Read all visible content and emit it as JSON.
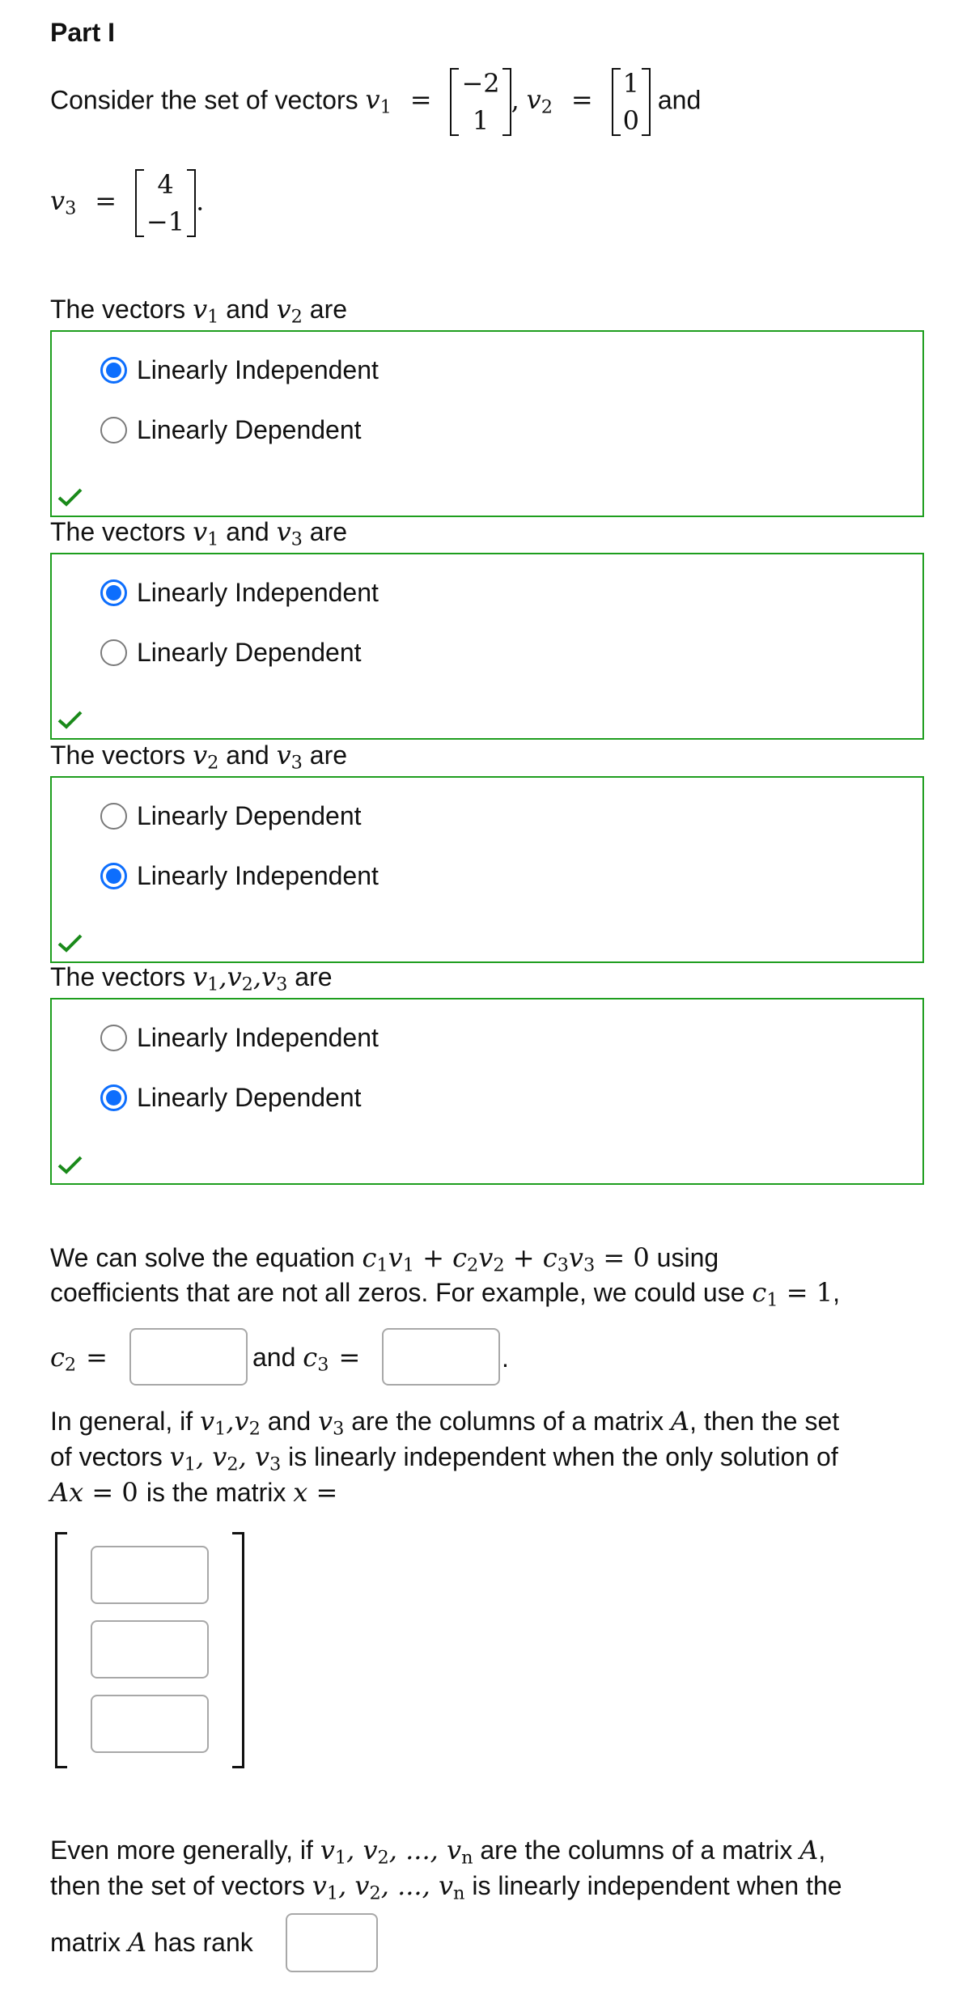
{
  "part_title": "Part I",
  "intro": {
    "prefix": "Consider the set of vectors",
    "v1_label": "v",
    "v1_sub": "1",
    "v1": [
      "−2",
      "1"
    ],
    "v2_label": "v",
    "v2_sub": "2",
    "v2": [
      "1",
      "0"
    ],
    "and": "and",
    "v3_label": "v",
    "v3_sub": "3",
    "v3": [
      "4",
      "−1"
    ],
    "eq": "=",
    "comma": ",",
    "period": "."
  },
  "questions": [
    {
      "label_prefix": "The vectors",
      "label_math": "v₁ and v₂",
      "a": "1",
      "b": "2",
      "mid": "and",
      "suffix": "are",
      "options": [
        {
          "label": "Linearly Independent",
          "selected": true
        },
        {
          "label": "Linearly Dependent",
          "selected": false
        }
      ],
      "status": "correct"
    },
    {
      "label_prefix": "The vectors",
      "a": "1",
      "b": "3",
      "mid": "and",
      "suffix": "are",
      "options": [
        {
          "label": "Linearly Independent",
          "selected": true
        },
        {
          "label": "Linearly Dependent",
          "selected": false
        }
      ],
      "status": "correct"
    },
    {
      "label_prefix": "The vectors",
      "a": "2",
      "b": "3",
      "mid": "and",
      "suffix": "are",
      "options": [
        {
          "label": "Linearly Dependent",
          "selected": false
        },
        {
          "label": "Linearly Independent",
          "selected": true
        }
      ],
      "status": "correct"
    },
    {
      "label_prefix": "The vectors",
      "a": "1",
      "b": "2",
      "c": "3",
      "suffix": "are",
      "options": [
        {
          "label": "Linearly Independent",
          "selected": false
        },
        {
          "label": "Linearly Dependent",
          "selected": true
        }
      ],
      "status": "correct"
    }
  ],
  "equation_para": {
    "line1_text": "We can solve the equation",
    "line1_end": "using",
    "line2_text": "coefficients that are not all zeros. For example, we could use",
    "c1_value": "1",
    "c2_value": "",
    "c3_value": "",
    "and": "and"
  },
  "general_para": {
    "line1_a": "In general, if",
    "line1_b": "and",
    "line1_c": "are the columns of a matrix",
    "line1_d": ", then the set",
    "line2_a": "of vectors",
    "line2_b": "is linearly independent when the only solution of",
    "line3_b": "is the matrix",
    "x_values": [
      "",
      "",
      ""
    ]
  },
  "rank_para": {
    "line1_a": "Even more generally, if",
    "line1_b": "are the columns of a matrix",
    "line2_a": "then the set of vectors",
    "line2_b": "is linearly independent when the",
    "line3_a": "matrix",
    "line3_b": "has rank",
    "rank_value": ""
  },
  "colors": {
    "correct_border": "#1e9e1e",
    "check": "#1a8a1a",
    "radio_selected": "#0d6efd"
  }
}
